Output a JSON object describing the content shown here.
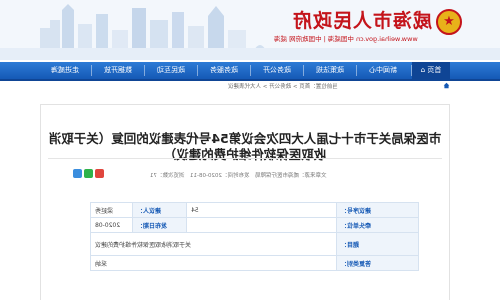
{
  "header": {
    "site_title": "威海市人民政府",
    "site_url": "www.weihai.gov.cn 中国威海 | 中国政府网 威海"
  },
  "nav": {
    "items": [
      "首页",
      "新闻中心",
      "政策法规",
      "政务公开",
      "政务服务",
      "政民互动",
      "数据开放",
      "走进威海"
    ]
  },
  "breadcrumb": "当前位置：首页 > 政务公开 > 人大代表建议",
  "article": {
    "title_line1": "市医保局关于市十七届人大四次会议第54号代表建议的回复（关于取消",
    "title_line2": "收取医保软件维护费的建议）",
    "meta": "文章来源：威海市医疗保障局　发布时间：2020-08-11　浏览次数：71"
  },
  "info": {
    "rows": [
      {
        "label1": "建议序号：",
        "value1": "54",
        "label2": "建议人：",
        "value2": "梁延秀"
      },
      {
        "label1": "牵头单位：",
        "value1": "",
        "label2": "发布日期：",
        "value2": "2020-08"
      },
      {
        "label1": "题目：",
        "value1": "关于取消收取医保软件维护费的建议",
        "label2": "",
        "value2": ""
      },
      {
        "label1": "答复类别：",
        "value1": "采纳",
        "label2": "",
        "value2": ""
      }
    ]
  }
}
